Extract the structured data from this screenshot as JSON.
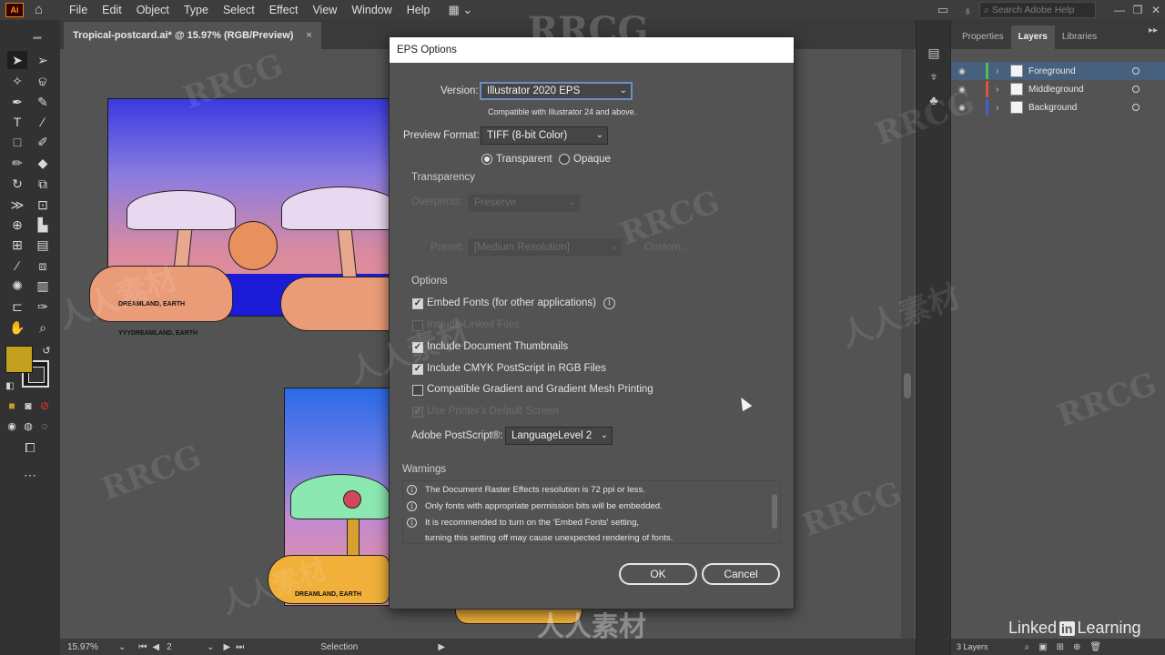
{
  "menubar": {
    "app_logo": "Ai",
    "items": [
      "File",
      "Edit",
      "Object",
      "Type",
      "Select",
      "Effect",
      "View",
      "Window",
      "Help"
    ],
    "search_placeholder": "Search Adobe Help"
  },
  "document_tab": {
    "title": "Tropical-postcard.ai* @ 15.97% (RGB/Preview)",
    "close": "×"
  },
  "artwork": {
    "top_postcard_text": "DREAMLAND, EARTH",
    "top_postcard_caption": "YYYDREAMLAND, EARTH",
    "bottom_postcard_text": "DREAMLAND, EARTH"
  },
  "status_bar": {
    "zoom": "15.97%",
    "artboard": "2",
    "tool": "Selection"
  },
  "right_panel": {
    "tabs": [
      "Properties",
      "Layers",
      "Libraries"
    ],
    "active_tab": "Layers",
    "layers": [
      {
        "name": "Foreground",
        "color": "#4fbf4f",
        "selected": true
      },
      {
        "name": "Middleground",
        "color": "#e0533a",
        "selected": false
      },
      {
        "name": "Background",
        "color": "#4060d0",
        "selected": false
      }
    ],
    "footer_count": "3 Layers"
  },
  "dialog": {
    "title": "EPS Options",
    "version_label": "Version:",
    "version_value": "Illustrator 2020 EPS",
    "version_note": "Compatible with Illustrator 24 and above.",
    "preview_label": "Preview Format:",
    "preview_value": "TIFF (8-bit Color)",
    "radio_transparent": "Transparent",
    "radio_opaque": "Opaque",
    "transparency_heading": "Transparency",
    "overprints_label": "Overprints:",
    "overprints_value": "Preserve",
    "preset_label": "Preset:",
    "preset_value": "[Medium Resolution]",
    "custom_button": "Custom...",
    "options_heading": "Options",
    "opt_embed_fonts": "Embed Fonts (for other applications)",
    "opt_linked_files": "Include Linked Files",
    "opt_thumbnails": "Include Document Thumbnails",
    "opt_cmyk": "Include CMYK PostScript in RGB Files",
    "opt_gradient": "Compatible Gradient and Gradient Mesh Printing",
    "opt_printer_screen": "Use Printer's Default Screen",
    "postscript_label": "Adobe PostScript®:",
    "postscript_value": "LanguageLevel 2",
    "warnings_heading": "Warnings",
    "warnings": [
      "The Document Raster Effects resolution is 72 ppi or less.",
      "Only fonts with appropriate permission bits will be embedded.",
      "It is recommended to turn on the 'Embed Fonts' setting,",
      "turning this setting off may cause unexpected rendering of fonts."
    ],
    "ok": "OK",
    "cancel": "Cancel"
  },
  "watermark": {
    "brand": "RRCG",
    "cjk": "人人素材",
    "linkedin": "Linked",
    "linkedin_in": "in",
    "learning": "Learning"
  }
}
